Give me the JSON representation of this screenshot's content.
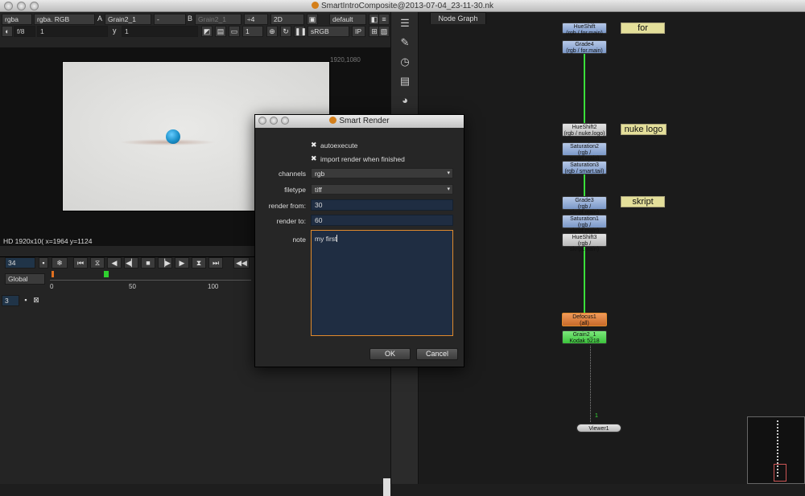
{
  "window": {
    "title": "SmartIntroComposite@2013-07-04_23-11-30.nk"
  },
  "viewer_toolbar": {
    "row1": {
      "channels": "rgba",
      "layer": "rgba. RGB",
      "a_label": "A",
      "a_input": "Grain2_1",
      "op": "-",
      "b_label": "B",
      "b_input": "Grain2_1",
      "zoom": "÷4",
      "mode": "2D",
      "lut": "default"
    },
    "row2": {
      "fstop": "f/8",
      "frame_x": "1",
      "y_label": "y",
      "frame_y": "1",
      "proxy": "1",
      "colorspace": "sRGB",
      "ip": "IP"
    }
  },
  "viewer": {
    "resolution": "1920,1080",
    "info": "HD 1920x10( x=1964 y=1124"
  },
  "timeline": {
    "frame": "34",
    "range_mode": "Global",
    "ticks": [
      "0",
      "50",
      "100"
    ],
    "step": "3"
  },
  "node_graph": {
    "tab": "Node Graph",
    "nodes": [
      {
        "name": "HueShift",
        "sub": "(rgb / for.main)"
      },
      {
        "name": "Grade4",
        "sub": "(rgb / for.main)"
      },
      {
        "name": "HueShift2",
        "sub": "(rgb / nuke.logo)"
      },
      {
        "name": "Saturation2",
        "sub": "(rgb / smart.main)"
      },
      {
        "name": "Saturation3",
        "sub": "(rgb / smart.tail)"
      },
      {
        "name": "Grade3",
        "sub": "(rgb / skript.main)"
      },
      {
        "name": "Saturation1",
        "sub": "(rgb / skript.main)"
      },
      {
        "name": "HueShift3",
        "sub": "(rgb / skript.main)"
      },
      {
        "name": "Defocus1",
        "sub": "(all)"
      },
      {
        "name": "Grain2_1",
        "sub": "Kodak 5218"
      },
      {
        "name": "Viewer1",
        "sub": ""
      }
    ],
    "stickies": [
      "for",
      "nuke logo",
      "skript"
    ],
    "viewer_input": "1"
  },
  "dialog": {
    "title": "Smart Render",
    "autoexecute": "autoexecute",
    "import_render": "import render when finished",
    "labels": {
      "channels": "channels",
      "filetype": "filetype",
      "render_from": "render from:",
      "render_to": "render to:",
      "note": "note"
    },
    "values": {
      "channels": "rgb",
      "filetype": "tiff",
      "render_from": "30",
      "render_to": "60",
      "note": "my first"
    },
    "ok": "OK",
    "cancel": "Cancel"
  },
  "colors": {
    "node_selected_outline": "#e08a2c",
    "dialog_field": "#1f2d42",
    "wire": "#3adf3a"
  }
}
